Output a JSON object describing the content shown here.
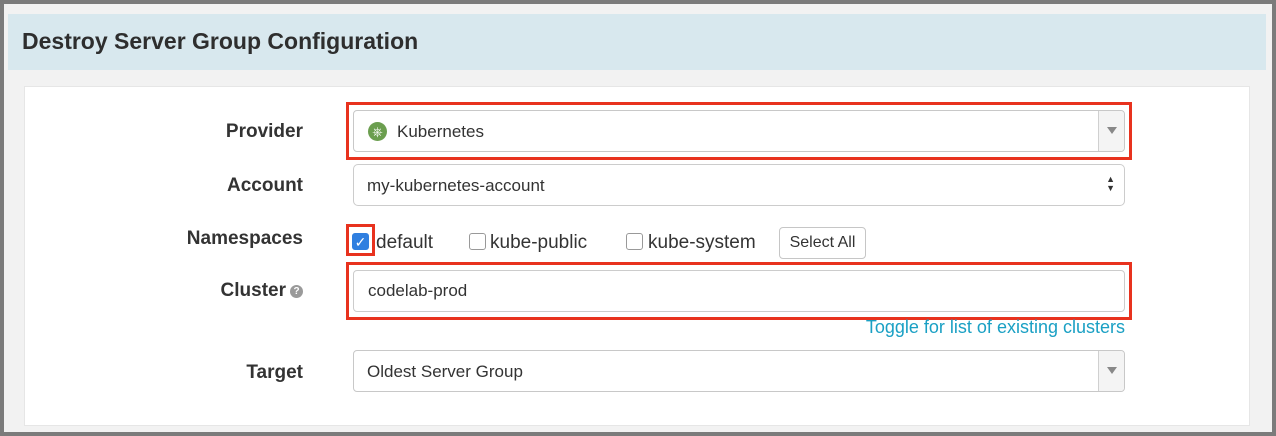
{
  "header": {
    "title": "Destroy Server Group Configuration"
  },
  "form": {
    "provider": {
      "label": "Provider",
      "value": "Kubernetes",
      "icon": "kubernetes-icon"
    },
    "account": {
      "label": "Account",
      "value": "my-kubernetes-account"
    },
    "namespaces": {
      "label": "Namespaces",
      "options": [
        {
          "label": "default",
          "checked": true
        },
        {
          "label": "kube-public",
          "checked": false
        },
        {
          "label": "kube-system",
          "checked": false
        }
      ],
      "select_all_label": "Select All"
    },
    "cluster": {
      "label": "Cluster",
      "value": "codelab-prod",
      "help_icon": "question-circle-icon",
      "toggle_link": "Toggle for list of existing clusters"
    },
    "target": {
      "label": "Target",
      "value": "Oldest Server Group"
    }
  },
  "colors": {
    "header_bg": "#d8e8ee",
    "highlight": "#e8321e",
    "link": "#1aa0c4",
    "checkbox_checked": "#2f7fe0"
  }
}
